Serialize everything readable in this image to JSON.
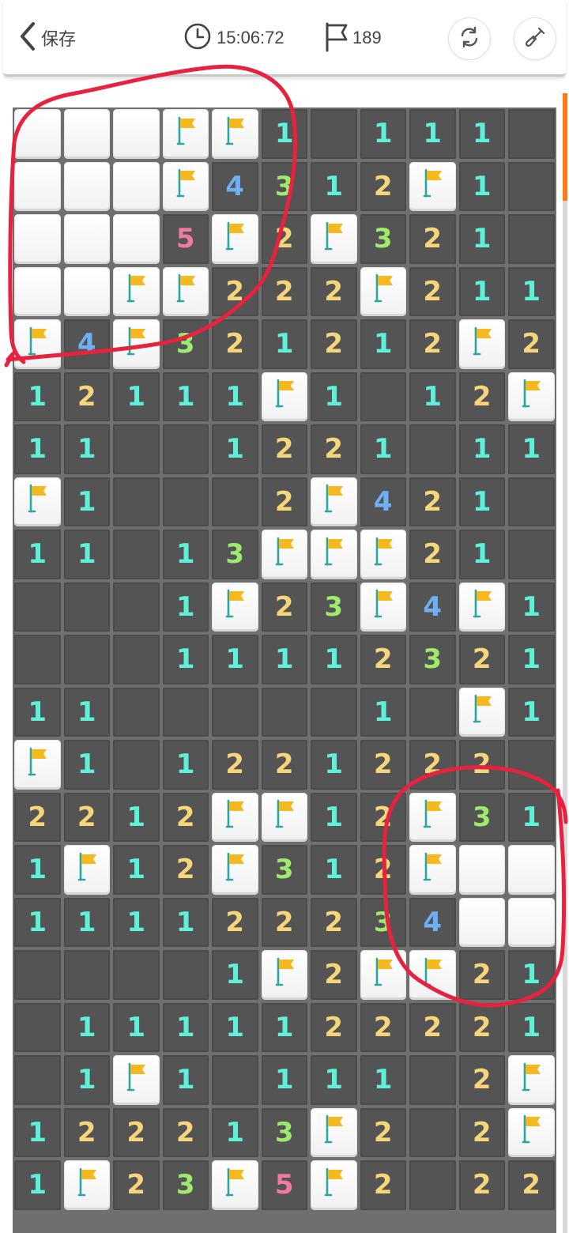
{
  "header": {
    "back_label": "保存",
    "timer": "15:06:72",
    "flag_count": "189"
  },
  "colors": {
    "accent": "#ff7a1a",
    "annotation": "#e8213f",
    "flag": "#f6b81f",
    "open_cell": "#545454",
    "grid_line": "#6f6f6f"
  },
  "icons": {
    "back": "chevron-left-icon",
    "timer": "clock-icon",
    "flags": "flag-outline-icon",
    "refresh": "refresh-icon",
    "hint": "shovel-icon",
    "cell_flag": "flag-icon"
  },
  "board": {
    "columns": 11,
    "legend": "C = unopened cell, F = flagged cell, 0 = opened empty, digit = adjacent mine count",
    "rows": [
      "CCCFF101110",
      "CCCF4312F10",
      "CCC5F2F3210",
      "CCFF222F211",
      "F4F321212F2",
      "12111F1012F",
      "11001221011",
      "F10002F4210",
      "11013FFF21",
      "0001F23F4F1",
      "00011112321",
      "110000010F10",
      "F1012212220",
      "2212FF12F31",
      "1F12F312FCC",
      "111122234CC",
      "00001F2FF21",
      "01111122221",
      "01F101110 2F",
      "12221 3F202F",
      "1F23F5F2022"
    ]
  }
}
